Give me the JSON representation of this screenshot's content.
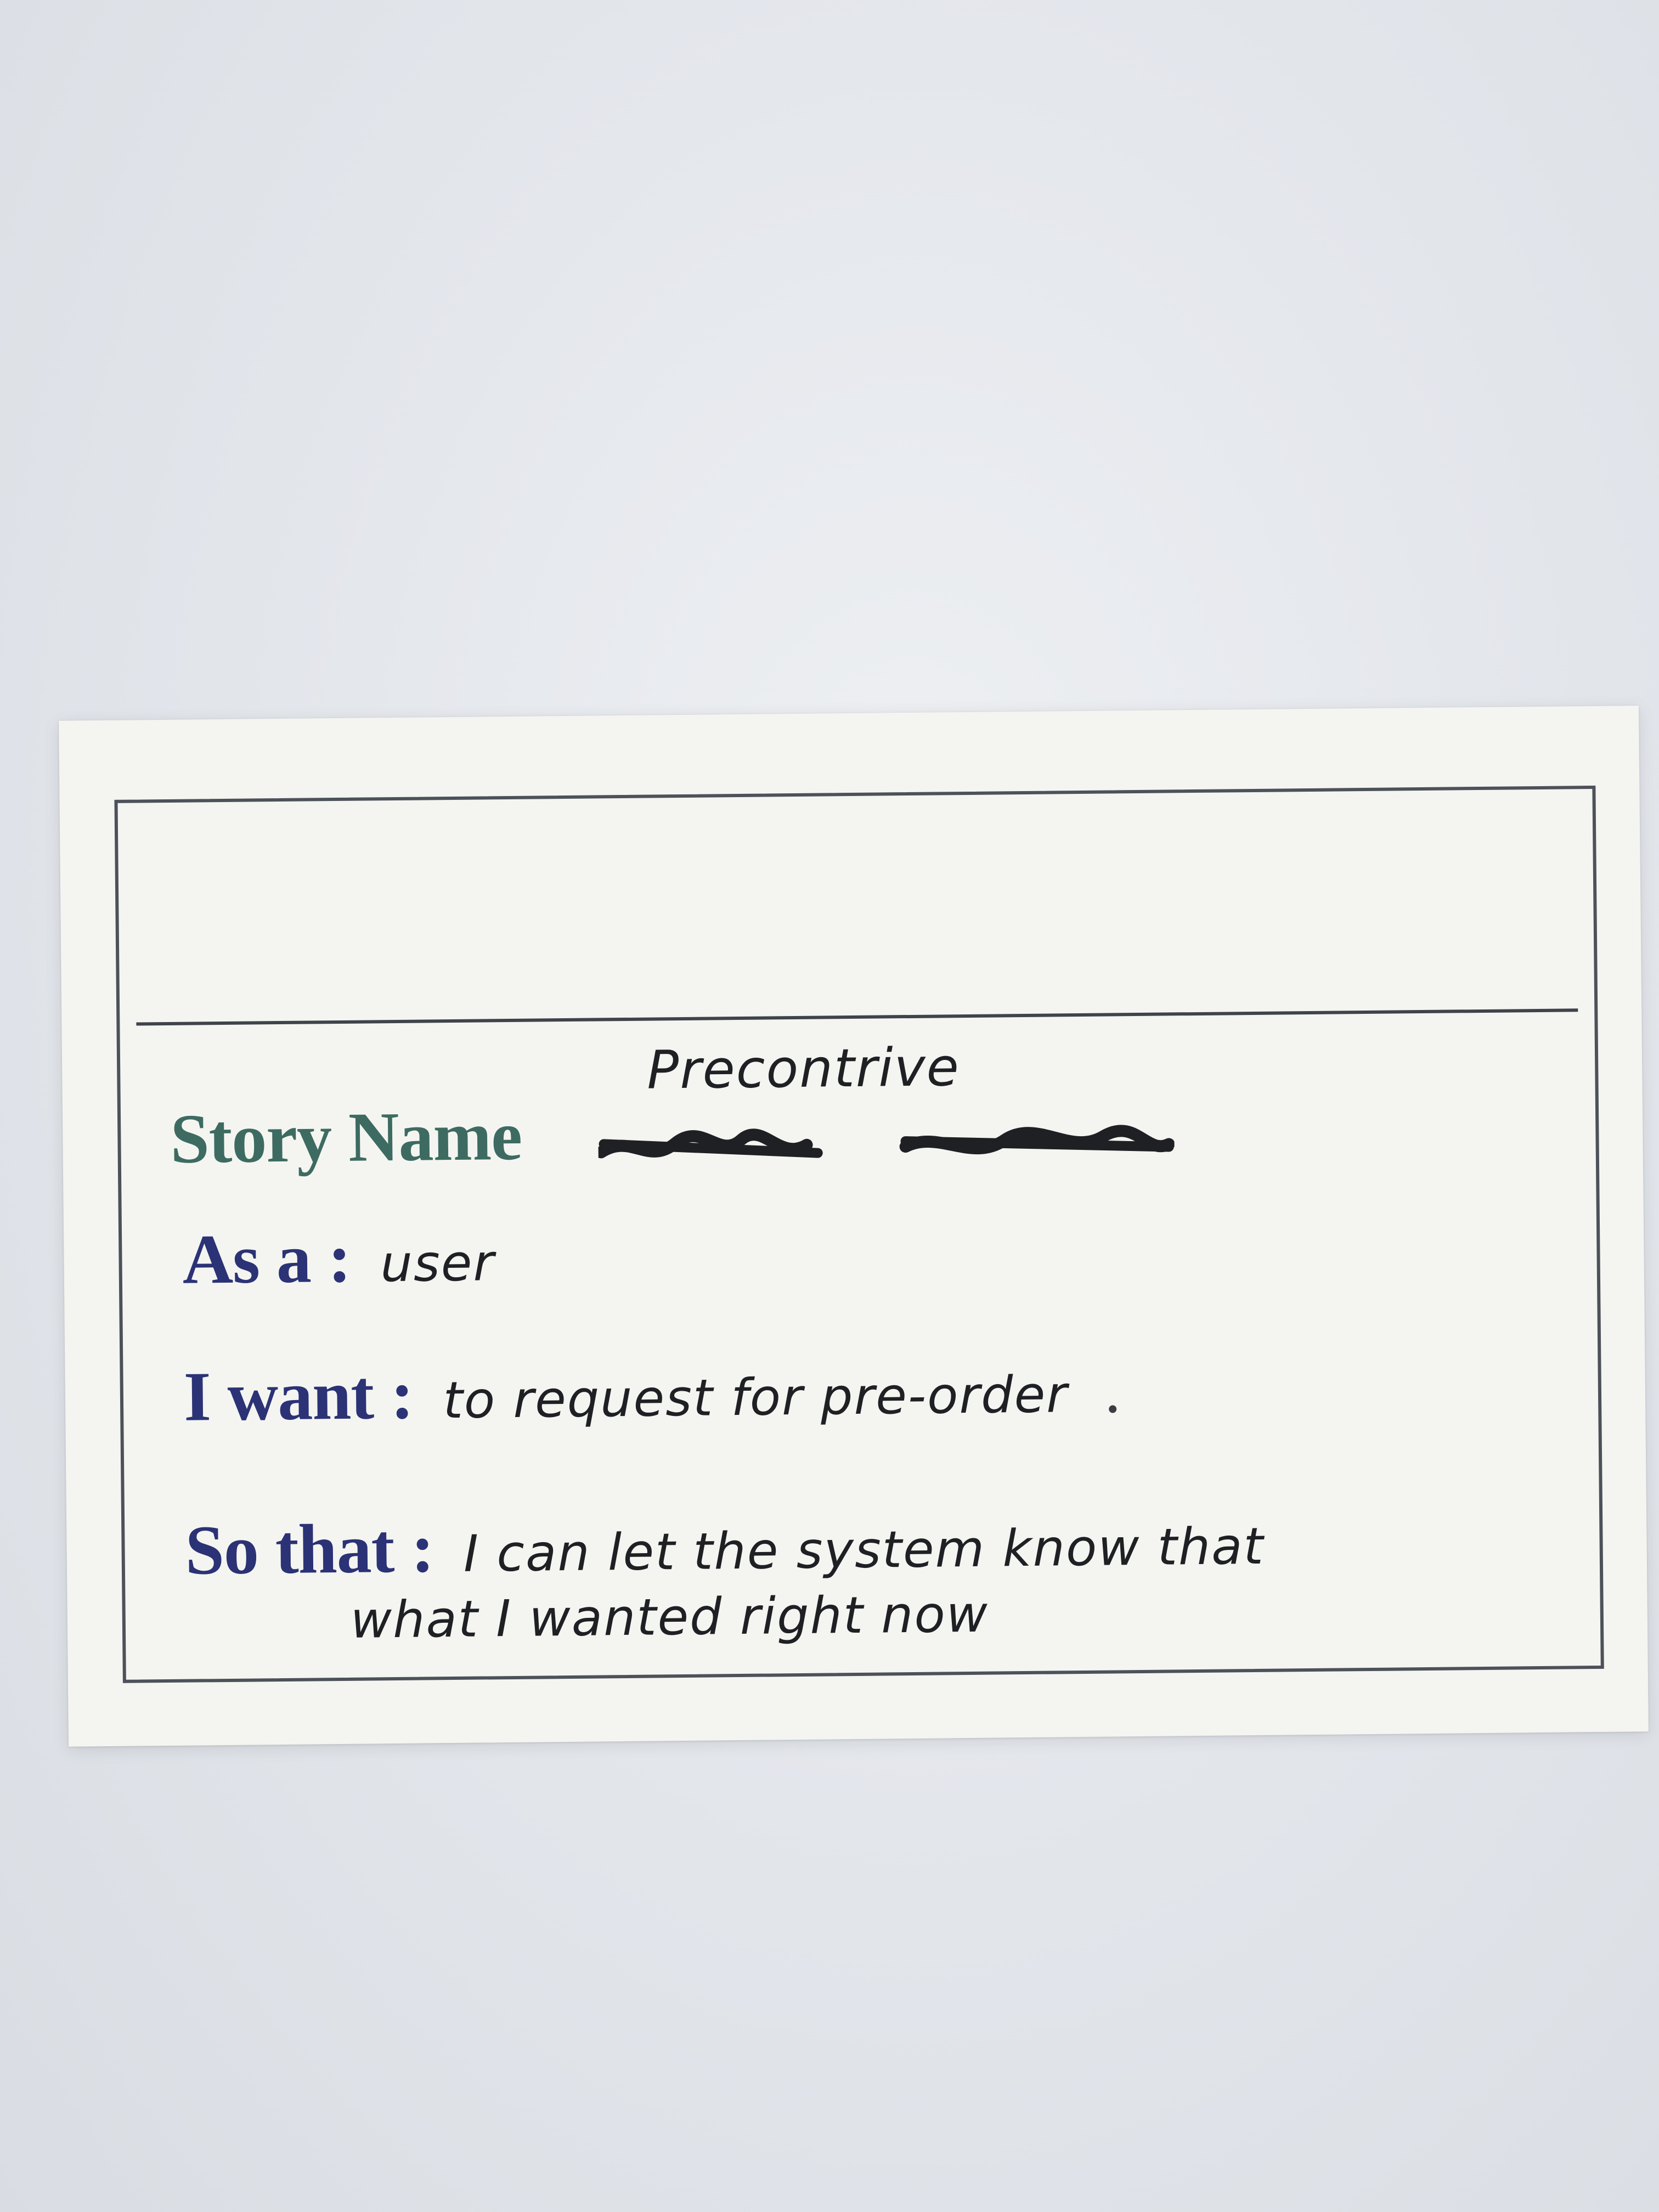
{
  "card": {
    "story_name_label": "Story Name",
    "story_name_value": "Precontrive",
    "as_a_label": "As a :",
    "as_a_value": "user",
    "i_want_label": "I want :",
    "i_want_value": "to request for pre-order",
    "so_that_label": "So that :",
    "so_that_line1": "I can let the system know that",
    "so_that_line2": "what I wanted right now"
  },
  "colors": {
    "story_label": "#3d6b61",
    "field_label": "#2b3275",
    "ink": "#1f2024",
    "frame": "#4d5159"
  }
}
